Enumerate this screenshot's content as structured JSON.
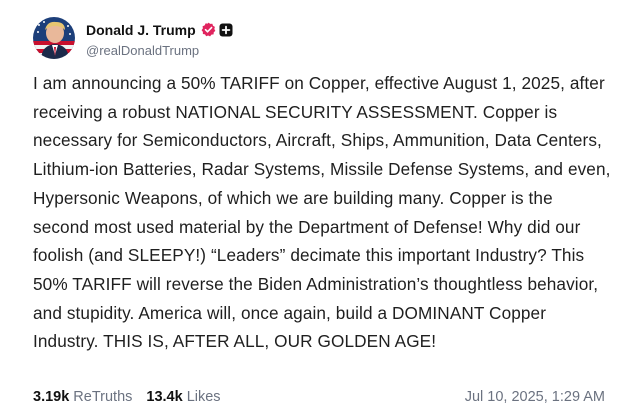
{
  "post": {
    "author": {
      "display_name": "Donald J. Trump",
      "handle": "@realDonaldTrump",
      "avatar_icon": "profile-avatar",
      "verified_icon": "verified-badge-icon",
      "verified_color": "#e0245e",
      "extra_badge_icon": "plus-badge-icon"
    },
    "text": "I am announcing a 50% TARIFF on Copper, effective August 1, 2025, after receiving a robust NATIONAL SECURITY ASSESSMENT. Copper is necessary for Semiconductors, Aircraft, Ships, Ammunition, Data Centers, Lithium-ion Batteries, Radar Systems, Missile Defense Systems, and even, Hypersonic Weapons, of which we are building many. Copper is the second most used material by the Department of Defense! Why did our foolish (and SLEEPY!) “Leaders” decimate this important Industry? This 50% TARIFF will reverse the Biden Administration’s thoughtless behavior, and stupidity. America will, once again, build a DOMINANT Copper Industry. THIS IS, AFTER ALL, OUR GOLDEN AGE!",
    "stats": {
      "retruths_count": "3.19k",
      "retruths_label": "ReTruths",
      "likes_count": "13.4k",
      "likes_label": "Likes"
    },
    "timestamp": "Jul 10, 2025, 1:29 AM"
  }
}
